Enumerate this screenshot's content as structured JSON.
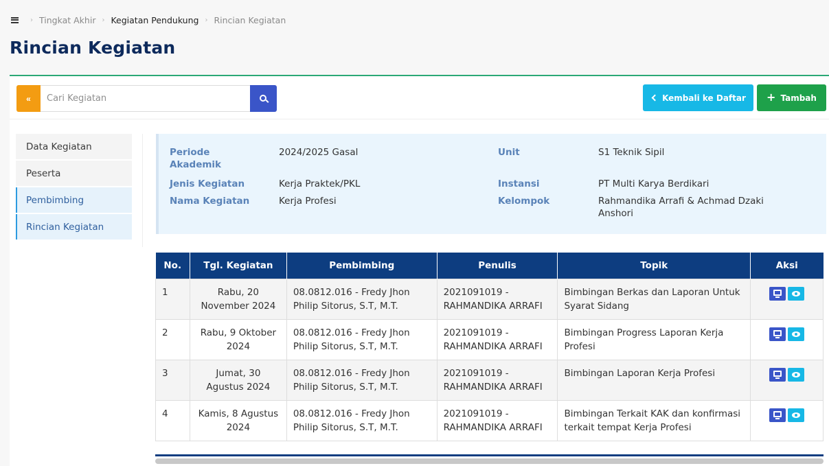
{
  "breadcrumb": {
    "items": [
      "Tingkat Akhir",
      "Kegiatan Pendukung",
      "Rincian Kegiatan"
    ]
  },
  "page": {
    "title": "Rincian Kegiatan"
  },
  "search": {
    "toggle_label": "«",
    "placeholder": "Cari Kegiatan",
    "value": ""
  },
  "actions": {
    "back_label": "Kembali ke Daftar",
    "add_label": "Tambah"
  },
  "colors": {
    "accent": "#0d3d80",
    "success": "#1ea14a",
    "info": "#17b8e6",
    "warning": "#f39c12",
    "primary": "#3a55c8"
  },
  "sidebar": {
    "items": [
      {
        "label": "Data Kegiatan",
        "active": false
      },
      {
        "label": "Peserta",
        "active": false
      },
      {
        "label": "Pembimbing",
        "active": true
      },
      {
        "label": "Rincian Kegiatan",
        "active": true
      }
    ]
  },
  "info": {
    "periode_label": "Periode Akademik",
    "periode_value": "2024/2025 Gasal",
    "jenis_label": "Jenis Kegiatan",
    "jenis_value": "Kerja Praktek/PKL",
    "nama_label": "Nama Kegiatan",
    "nama_value": "Kerja Profesi",
    "unit_label": "Unit",
    "unit_value": "S1 Teknik Sipil",
    "instansi_label": "Instansi",
    "instansi_value": "PT Multi Karya Berdikari",
    "kelompok_label": "Kelompok",
    "kelompok_value": "Rahmandika Arrafi & Achmad Dzaki Anshori"
  },
  "table": {
    "headers": [
      "No.",
      "Tgl. Kegiatan",
      "Pembimbing",
      "Penulis",
      "Topik",
      "Aksi"
    ],
    "rows": [
      {
        "no": "1",
        "tgl": "Rabu, 20 November 2024",
        "pembimbing": "08.0812.016 - Fredy Jhon Philip Sitorus, S.T, M.T.",
        "penulis": "2021091019 - RAHMANDIKA ARRAFI",
        "topik": "Bimbingan Berkas dan Laporan Untuk Syarat Sidang"
      },
      {
        "no": "2",
        "tgl": "Rabu, 9 Oktober 2024",
        "pembimbing": "08.0812.016 - Fredy Jhon Philip Sitorus, S.T, M.T.",
        "penulis": "2021091019 - RAHMANDIKA ARRAFI",
        "topik": "Bimbingan Progress Laporan Kerja Profesi"
      },
      {
        "no": "3",
        "tgl": "Jumat, 30 Agustus 2024",
        "pembimbing": "08.0812.016 - Fredy Jhon Philip Sitorus, S.T, M.T.",
        "penulis": "2021091019 - RAHMANDIKA ARRAFI",
        "topik": "Bimbingan Laporan Kerja Profesi"
      },
      {
        "no": "4",
        "tgl": "Kamis, 8 Agustus 2024",
        "pembimbing": "08.0812.016 - Fredy Jhon Philip Sitorus, S.T, M.T.",
        "penulis": "2021091019 - RAHMANDIKA ARRAFI",
        "topik": "Bimbingan Terkait KAK dan konfirmasi terkait tempat Kerja Profesi"
      }
    ]
  }
}
